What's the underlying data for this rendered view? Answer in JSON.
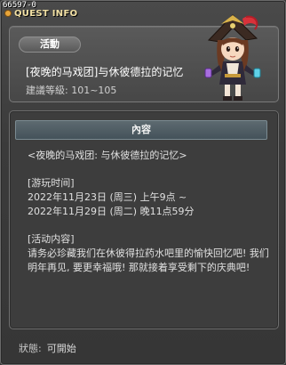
{
  "window": {
    "id": "66597-0",
    "title": "QUEST INFO"
  },
  "header": {
    "category": "活動",
    "quest_title": "[夜晚的马戏团]与休彼德拉的记忆",
    "level_req": "建議等級: 101~105"
  },
  "content": {
    "heading": "內容",
    "subtitle": "<夜晚的马戏团: 与休彼德拉的记忆>",
    "play_time_label": "[游玩时间]",
    "play_time_start": "2022年11月23日 (周三) 上午9点 ~",
    "play_time_end": "2022年11月29日 (周二) 晚11点59分",
    "activity_label": "[活动内容]",
    "activity_text": "请务必珍藏我们在休彼得拉药水吧里的愉快回忆吧! 我们明年再见, 要更幸福哦! 那就接着享受剩下的庆典吧!"
  },
  "status": {
    "label": "狀態:",
    "value": "可開始"
  },
  "colors": {
    "title_accent": "#f3e1a4",
    "panel_header": "#4f5d64"
  },
  "icons": [
    "quest-badge-icon",
    "character-portrait"
  ]
}
